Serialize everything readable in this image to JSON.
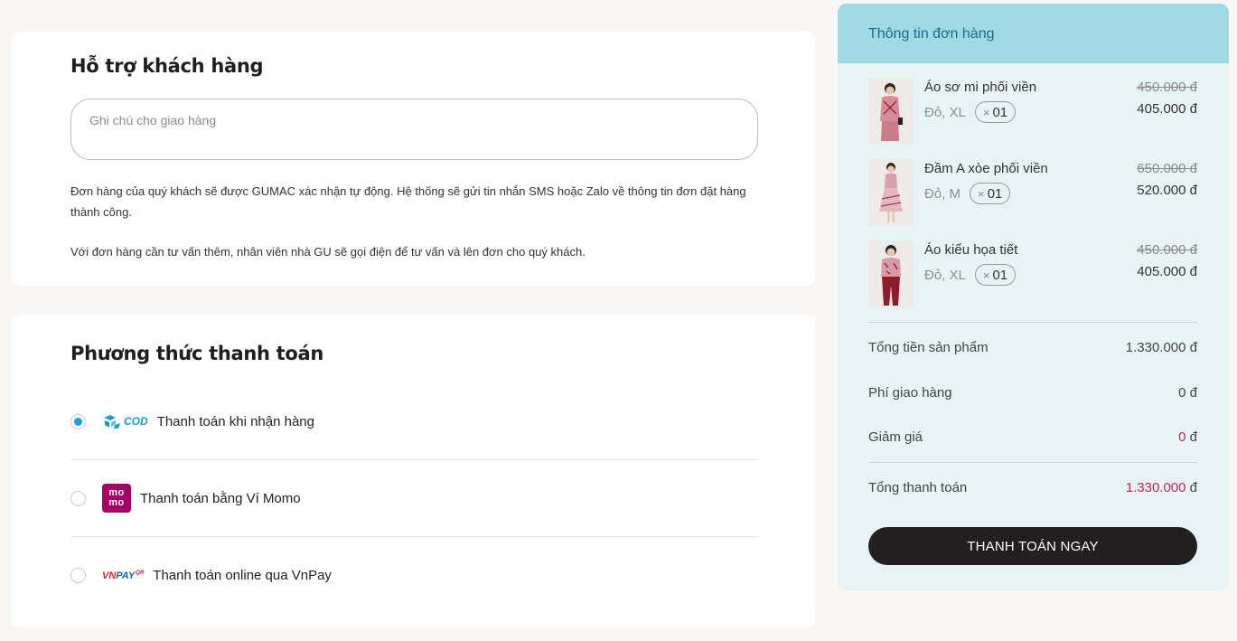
{
  "support": {
    "title": "Hỗ trợ khách hàng",
    "note_placeholder": "Ghi chú cho giao hàng",
    "note_value": "",
    "paragraph_1": "Đơn hàng của quý khách sẽ được GUMAC xác nhận tự động. Hệ thống sẽ gửi tin nhắn SMS hoặc Zalo về thông tin đơn đặt hàng thành công.",
    "paragraph_2": "Với đơn hàng cần tư vấn thêm, nhân viên nhà GU sẽ gọi điện để tư vấn và lên đơn cho quý khách."
  },
  "payment": {
    "title": "Phương thức thanh toán",
    "selected": "cod",
    "methods": [
      {
        "id": "cod",
        "logo_text": "COD",
        "icon": "delivery-truck-icon",
        "label": "Thanh toán khi nhận hàng",
        "checked": true
      },
      {
        "id": "momo",
        "logo_text": [
          "mo",
          "mo"
        ],
        "icon": "momo-logo",
        "label": "Thanh toán bằng Ví Momo",
        "checked": false
      },
      {
        "id": "vnpay",
        "logo_text": {
          "vn": "VN",
          "pay": "PAY",
          "qr": "QR"
        },
        "icon": "vnpay-logo",
        "label": "Thanh toán online qua VnPay",
        "checked": false
      }
    ]
  },
  "order": {
    "header": "Thông tin đơn hàng",
    "items": [
      {
        "name": "Áo sơ mi phối viền",
        "variant": "Đỏ, XL",
        "qty_prefix": "×",
        "qty": "01",
        "price_old": "450.000 đ",
        "price_new": "405.000 đ"
      },
      {
        "name": "Đầm A xòe phối viền",
        "variant": "Đỏ, M",
        "qty_prefix": "×",
        "qty": "01",
        "price_old": "650.000 đ",
        "price_new": "520.000 đ"
      },
      {
        "name": "Áo kiểu họa tiết",
        "variant": "Đỏ, XL",
        "qty_prefix": "×",
        "qty": "01",
        "price_old": "450.000 đ",
        "price_new": "405.000 đ"
      }
    ],
    "summary": {
      "subtotal_label": "Tổng tiền sản phẩm",
      "subtotal_value": "1.330.000 đ",
      "shipping_label": "Phí giao hàng",
      "shipping_value": "0 đ",
      "discount_label": "Giảm giá",
      "discount_amount": "0",
      "discount_currency": " đ",
      "total_label": "Tổng thanh toán",
      "total_amount": "1.330.000",
      "total_currency": " đ"
    },
    "checkout_label": "THANH TOÁN NGAY"
  },
  "colors": {
    "accent_price": "#cf1f4c",
    "order_header_bg": "#9fd9e2",
    "order_panel_bg": "#e6f4f5",
    "radio_selected": "#1e9fe0",
    "button_bg": "#231f20"
  }
}
